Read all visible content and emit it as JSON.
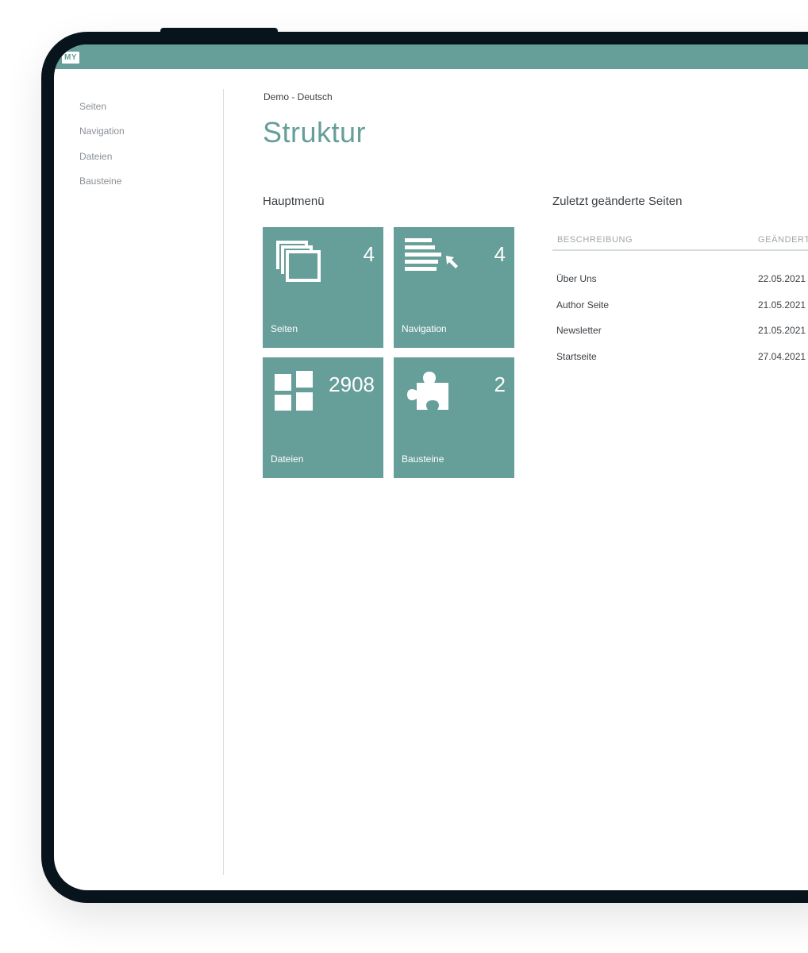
{
  "app": {
    "logo_text": "MY"
  },
  "sidebar": {
    "items": [
      {
        "label": "Seiten"
      },
      {
        "label": "Navigation"
      },
      {
        "label": "Dateien"
      },
      {
        "label": "Bausteine"
      }
    ]
  },
  "header": {
    "breadcrumb": "Demo - Deutsch",
    "title": "Struktur"
  },
  "main_menu": {
    "heading": "Hauptmenü",
    "tiles": [
      {
        "label": "Seiten",
        "count": "4",
        "icon": "pages-icon"
      },
      {
        "label": "Navigation",
        "count": "4",
        "icon": "navigation-icon"
      },
      {
        "label": "Dateien",
        "count": "2908",
        "icon": "files-grid-icon"
      },
      {
        "label": "Bausteine",
        "count": "2",
        "icon": "puzzle-icon"
      }
    ]
  },
  "recent_pages": {
    "heading": "Zuletzt geänderte Seiten",
    "columns": [
      "BESCHREIBUNG",
      "GEÄNDERT"
    ],
    "rows": [
      {
        "description": "Über Uns",
        "changed": "22.05.2021"
      },
      {
        "description": "Author Seite",
        "changed": "21.05.2021"
      },
      {
        "description": "Newsletter",
        "changed": "21.05.2021"
      },
      {
        "description": "Startseite",
        "changed": "27.04.2021"
      }
    ]
  },
  "colors": {
    "accent": "#669e99",
    "device_frame": "#07141c",
    "text": "#3c4146",
    "muted_text": "#8b9095"
  }
}
